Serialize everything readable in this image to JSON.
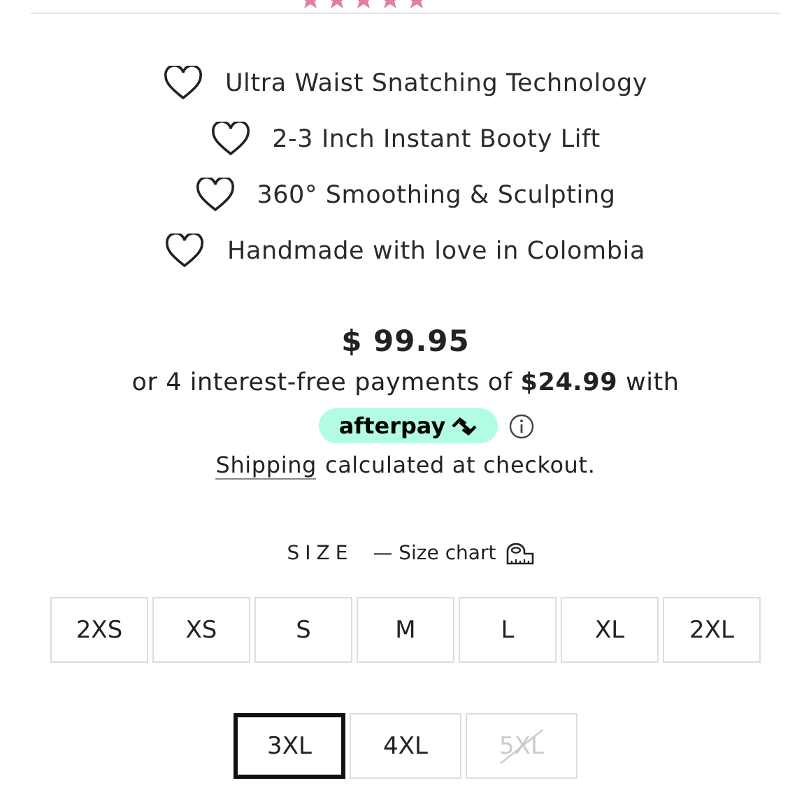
{
  "rating": {
    "stars": 5
  },
  "features": [
    "Ultra Waist Snatching Technology",
    "2-3 Inch Instant Booty Lift",
    "360° Smoothing & Sculpting",
    "Handmade with love in Colombia"
  ],
  "price": "$ 99.95",
  "installments": "or 4 interest-free payments of **$24.99** with",
  "afterpay": "afterpay",
  "shipping_link": "Shipping",
  "shipping_text": "calculated at checkout.",
  "size_label": "SIZE",
  "size_chart": "— Size chart",
  "sizes": [
    {
      "label": "2XS",
      "selected": false,
      "disabled": false
    },
    {
      "label": "XS",
      "selected": false,
      "disabled": false
    },
    {
      "label": "S",
      "selected": false,
      "disabled": false
    },
    {
      "label": "M",
      "selected": false,
      "disabled": false
    },
    {
      "label": "L",
      "selected": false,
      "disabled": false
    },
    {
      "label": "XL",
      "selected": false,
      "disabled": false
    },
    {
      "label": "2XL",
      "selected": false,
      "disabled": false
    },
    {
      "label": "3XL",
      "selected": true,
      "disabled": false
    },
    {
      "label": "4XL",
      "selected": false,
      "disabled": false
    },
    {
      "label": "5XL",
      "selected": false,
      "disabled": true
    }
  ]
}
